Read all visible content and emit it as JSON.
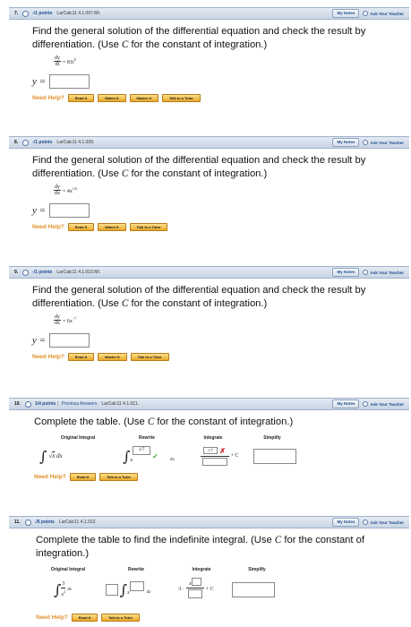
{
  "common": {
    "need_help": "Need Help?",
    "read_it": "Read It",
    "watch_it": "Watch It",
    "master_it": "Master It",
    "talk_tutor": "Talk to a Tutor",
    "my_notes": "My Notes",
    "ask_teacher": "Ask Your Teacher",
    "y_eq": "y =",
    "plus_c": "+ C"
  },
  "questions": [
    {
      "num": "7.",
      "points": "-/1 points",
      "ref": "LarCalc11 4.1.007.MI.",
      "prompt": "Find the general solution of the differential equation and check the result by differentiation. (Use ",
      "prompt_c": "C",
      "prompt_end": " for the constant of integration.)",
      "eq_num": "dy",
      "eq_den": "dt",
      "eq_rhs": "= 81t",
      "eq_sup": "8"
    },
    {
      "num": "8.",
      "points": "-/1 points",
      "ref": "LarCalc11 4.1.009.",
      "prompt": "Find the general solution of the differential equation and check the result by differentiation. (Use ",
      "prompt_c": "C",
      "prompt_end": " for the constant of integration.)",
      "eq_num": "dy",
      "eq_den": "dx",
      "eq_rhs": "= 4x",
      "eq_sup": "1/6"
    },
    {
      "num": "9.",
      "points": "-/1 points",
      "ref": "LarCalc11 4.1.010.MI.",
      "prompt": "Find the general solution of the differential equation and check the result by differentiation. (Use ",
      "prompt_c": "C",
      "prompt_end": " for the constant of integration.)",
      "eq_num": "dy",
      "eq_den": "dx",
      "eq_rhs": "= 6x",
      "eq_sup": "−7"
    },
    {
      "num": "10.",
      "points": "1/4 points",
      "previous": "Previous Answers",
      "ref": "LarCalc11 4.1.011.",
      "prompt": "Complete the table. (Use ",
      "prompt_c": "C",
      "prompt_end": " for the constant of integration.)",
      "headers": [
        "Original Integral",
        "Rewrite",
        "Integrate",
        "Simplify"
      ],
      "rewrite_value": "1/7",
      "integrate_value": "1/7",
      "dx": "dx"
    },
    {
      "num": "11.",
      "points": "-/5 points",
      "ref": "LarCalc11 4.1.012.",
      "prompt": "Complete the table to find the indefinite integral. (Use ",
      "prompt_c": "C",
      "prompt_end": " for the constant of integration.)",
      "headers": [
        "Original Integral",
        "Rewrite",
        "Integrate",
        "Simplify"
      ],
      "orig_num": "3",
      "orig_den": "x",
      "orig_sup": "2",
      "dx": "dx",
      "integrate_coef": "3 ·"
    }
  ]
}
